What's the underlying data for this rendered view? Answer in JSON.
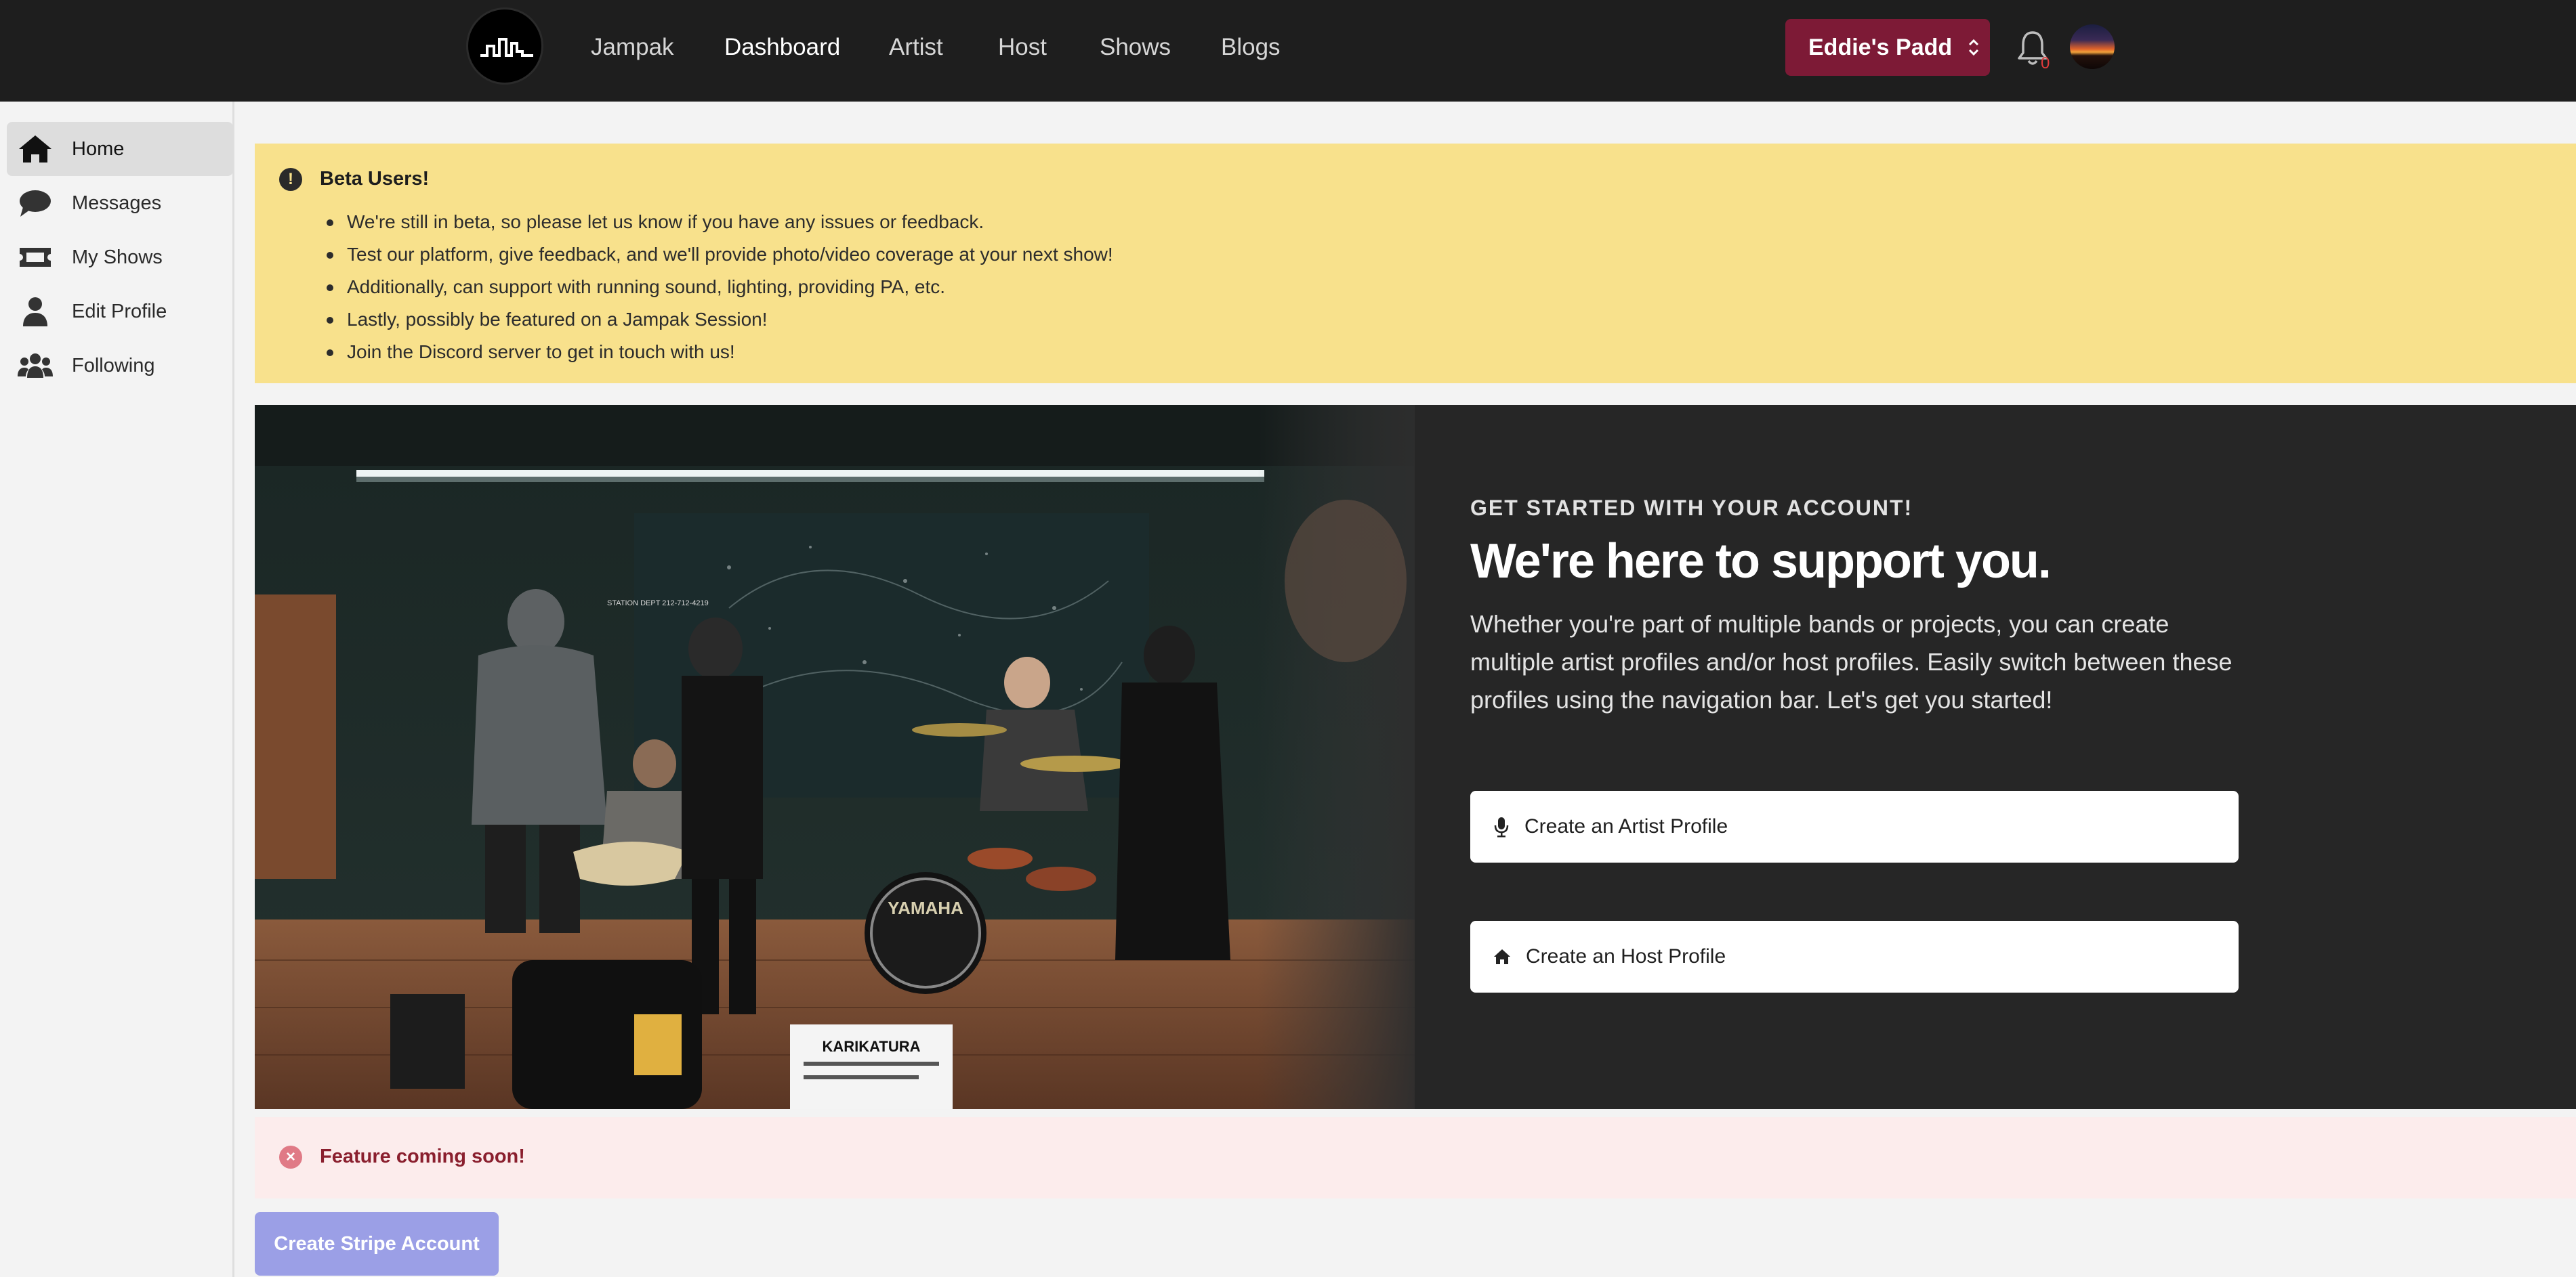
{
  "nav": {
    "links": [
      "Jampak",
      "Dashboard",
      "Artist",
      "Host",
      "Shows",
      "Blogs"
    ],
    "active": "Dashboard",
    "profile_switcher": "Eddie's Padd",
    "notification_count": "0"
  },
  "sidebar": {
    "items": [
      {
        "label": "Home",
        "icon": "home-icon"
      },
      {
        "label": "Messages",
        "icon": "chat-bubble-icon"
      },
      {
        "label": "My Shows",
        "icon": "ticket-icon"
      },
      {
        "label": "Edit Profile",
        "icon": "user-icon"
      },
      {
        "label": "Following",
        "icon": "users-icon"
      }
    ],
    "active": "Home"
  },
  "beta_banner": {
    "title": "Beta Users!",
    "items": [
      "We're still in beta, so please let us know if you have any issues or feedback.",
      "Test our platform, give feedback, and we'll provide photo/video coverage at your next show!",
      "Additionally, can support with running sound, lighting, providing PA, etc.",
      "Lastly, possibly be featured on a Jampak Session!",
      "Join the Discord server to get in touch with us!"
    ]
  },
  "hero": {
    "eyebrow": "GET STARTED WITH YOUR ACCOUNT!",
    "title": "We're here to support you.",
    "description": "Whether you're part of multiple bands or projects, you can create multiple artist profiles and/or host profiles. Easily switch between these profiles using the navigation bar. Let's get you started!",
    "artist_button": "Create an Artist Profile",
    "host_button": "Create an Host Profile",
    "photo_texts": {
      "bass_drum": "YAMAHA",
      "sign": "KARIKATURA",
      "wall_sign": "STATION DEPT 212-712-4219"
    }
  },
  "error_banner": {
    "text": "Feature coming soon!"
  },
  "stripe_button": "Create Stripe Account",
  "colors": {
    "topbar": "#1e1e1e",
    "profile_switcher": "#7d1a36",
    "beta_bg": "#f8e18c",
    "hero_bg": "#262626",
    "error_bg": "#fcecec",
    "stripe_button": "#9b9fe6"
  }
}
